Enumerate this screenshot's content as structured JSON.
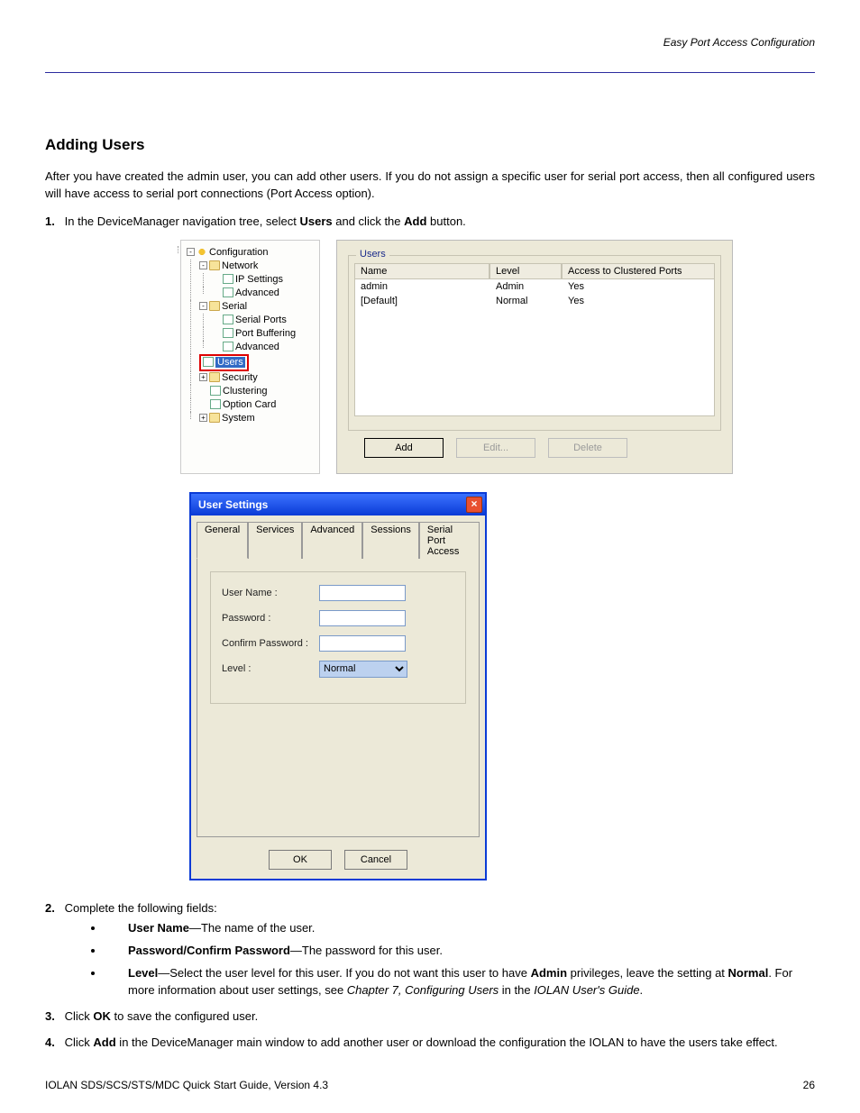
{
  "header": {
    "left_running": "Easy Port Access Configuration"
  },
  "section": {
    "title": "Adding Users",
    "intro1": "After you have created the admin user, you can add other users. If you do not assign a specific user for serial port access, then all configured users will have access to serial port connections (Port Access option).",
    "steps": {
      "s1_num": "1.",
      "s1_text_a": "In the DeviceManager navigation tree, select ",
      "s1_text_b": " and click the ",
      "s1_text_c": " button.",
      "users_bold": "Users",
      "add_bold": "Add"
    }
  },
  "tree": {
    "root": "Configuration",
    "network": "Network",
    "ip": "IP Settings",
    "advanced": "Advanced",
    "serial": "Serial",
    "serial_ports": "Serial Ports",
    "port_buffering": "Port Buffering",
    "adv2": "Advanced",
    "users": "Users",
    "security": "Security",
    "clustering": "Clustering",
    "option_card": "Option Card",
    "system": "System"
  },
  "users_panel": {
    "group": "Users",
    "col_name": "Name",
    "col_level": "Level",
    "col_access": "Access to Clustered Ports",
    "rows": [
      {
        "name": "admin",
        "level": "Admin",
        "access": "Yes"
      },
      {
        "name": "[Default]",
        "level": "Normal",
        "access": "Yes"
      }
    ],
    "add": "Add",
    "edit": "Edit...",
    "delete": "Delete"
  },
  "dialog": {
    "title": "User Settings",
    "tabs": {
      "general": "General",
      "services": "Services",
      "advanced": "Advanced",
      "sessions": "Sessions",
      "spa": "Serial Port Access"
    },
    "form": {
      "username_label": "User Name :",
      "password_label": "Password :",
      "confirm_label": "Confirm Password :",
      "level_label": "Level :",
      "level_value": "Normal"
    },
    "ok": "OK",
    "cancel": "Cancel"
  },
  "after": {
    "s2_num": "2.",
    "s2_text": "Complete the following fields:",
    "bullets": {
      "b1_label": "User Name",
      "b1_text": "—The name of the user.",
      "b2_label": "Password/Confirm Password",
      "b2_text": "—The password for this user.",
      "b3_label": "Level",
      "b3_text_a": "—Select the user level for this user. If you do not want this user to have ",
      "b3_text_b": " privileges, leave the setting at ",
      "b3_text_c": ". For more information about user settings, see ",
      "b3_text_d": " in the ",
      "b3_text_e": ".",
      "admin_word": "Admin",
      "normal_word": "Normal",
      "chapter": "Chapter 7, Configuring Users",
      "guide": "IOLAN User's Guide"
    },
    "s3_num": "3.",
    "s3_a": "Click ",
    "s3_b": " to save the configured user.",
    "ok_word": "OK",
    "s4_num": "4.",
    "s4_a": "Click ",
    "s4_b": " in the DeviceManager main window to add another user or download the configuration the IOLAN to have the users take effect.",
    "add_word": "Add"
  },
  "footer": {
    "guide": "IOLAN SDS/SCS/STS/MDC Quick Start Guide, Version 4.3",
    "page": "26"
  }
}
